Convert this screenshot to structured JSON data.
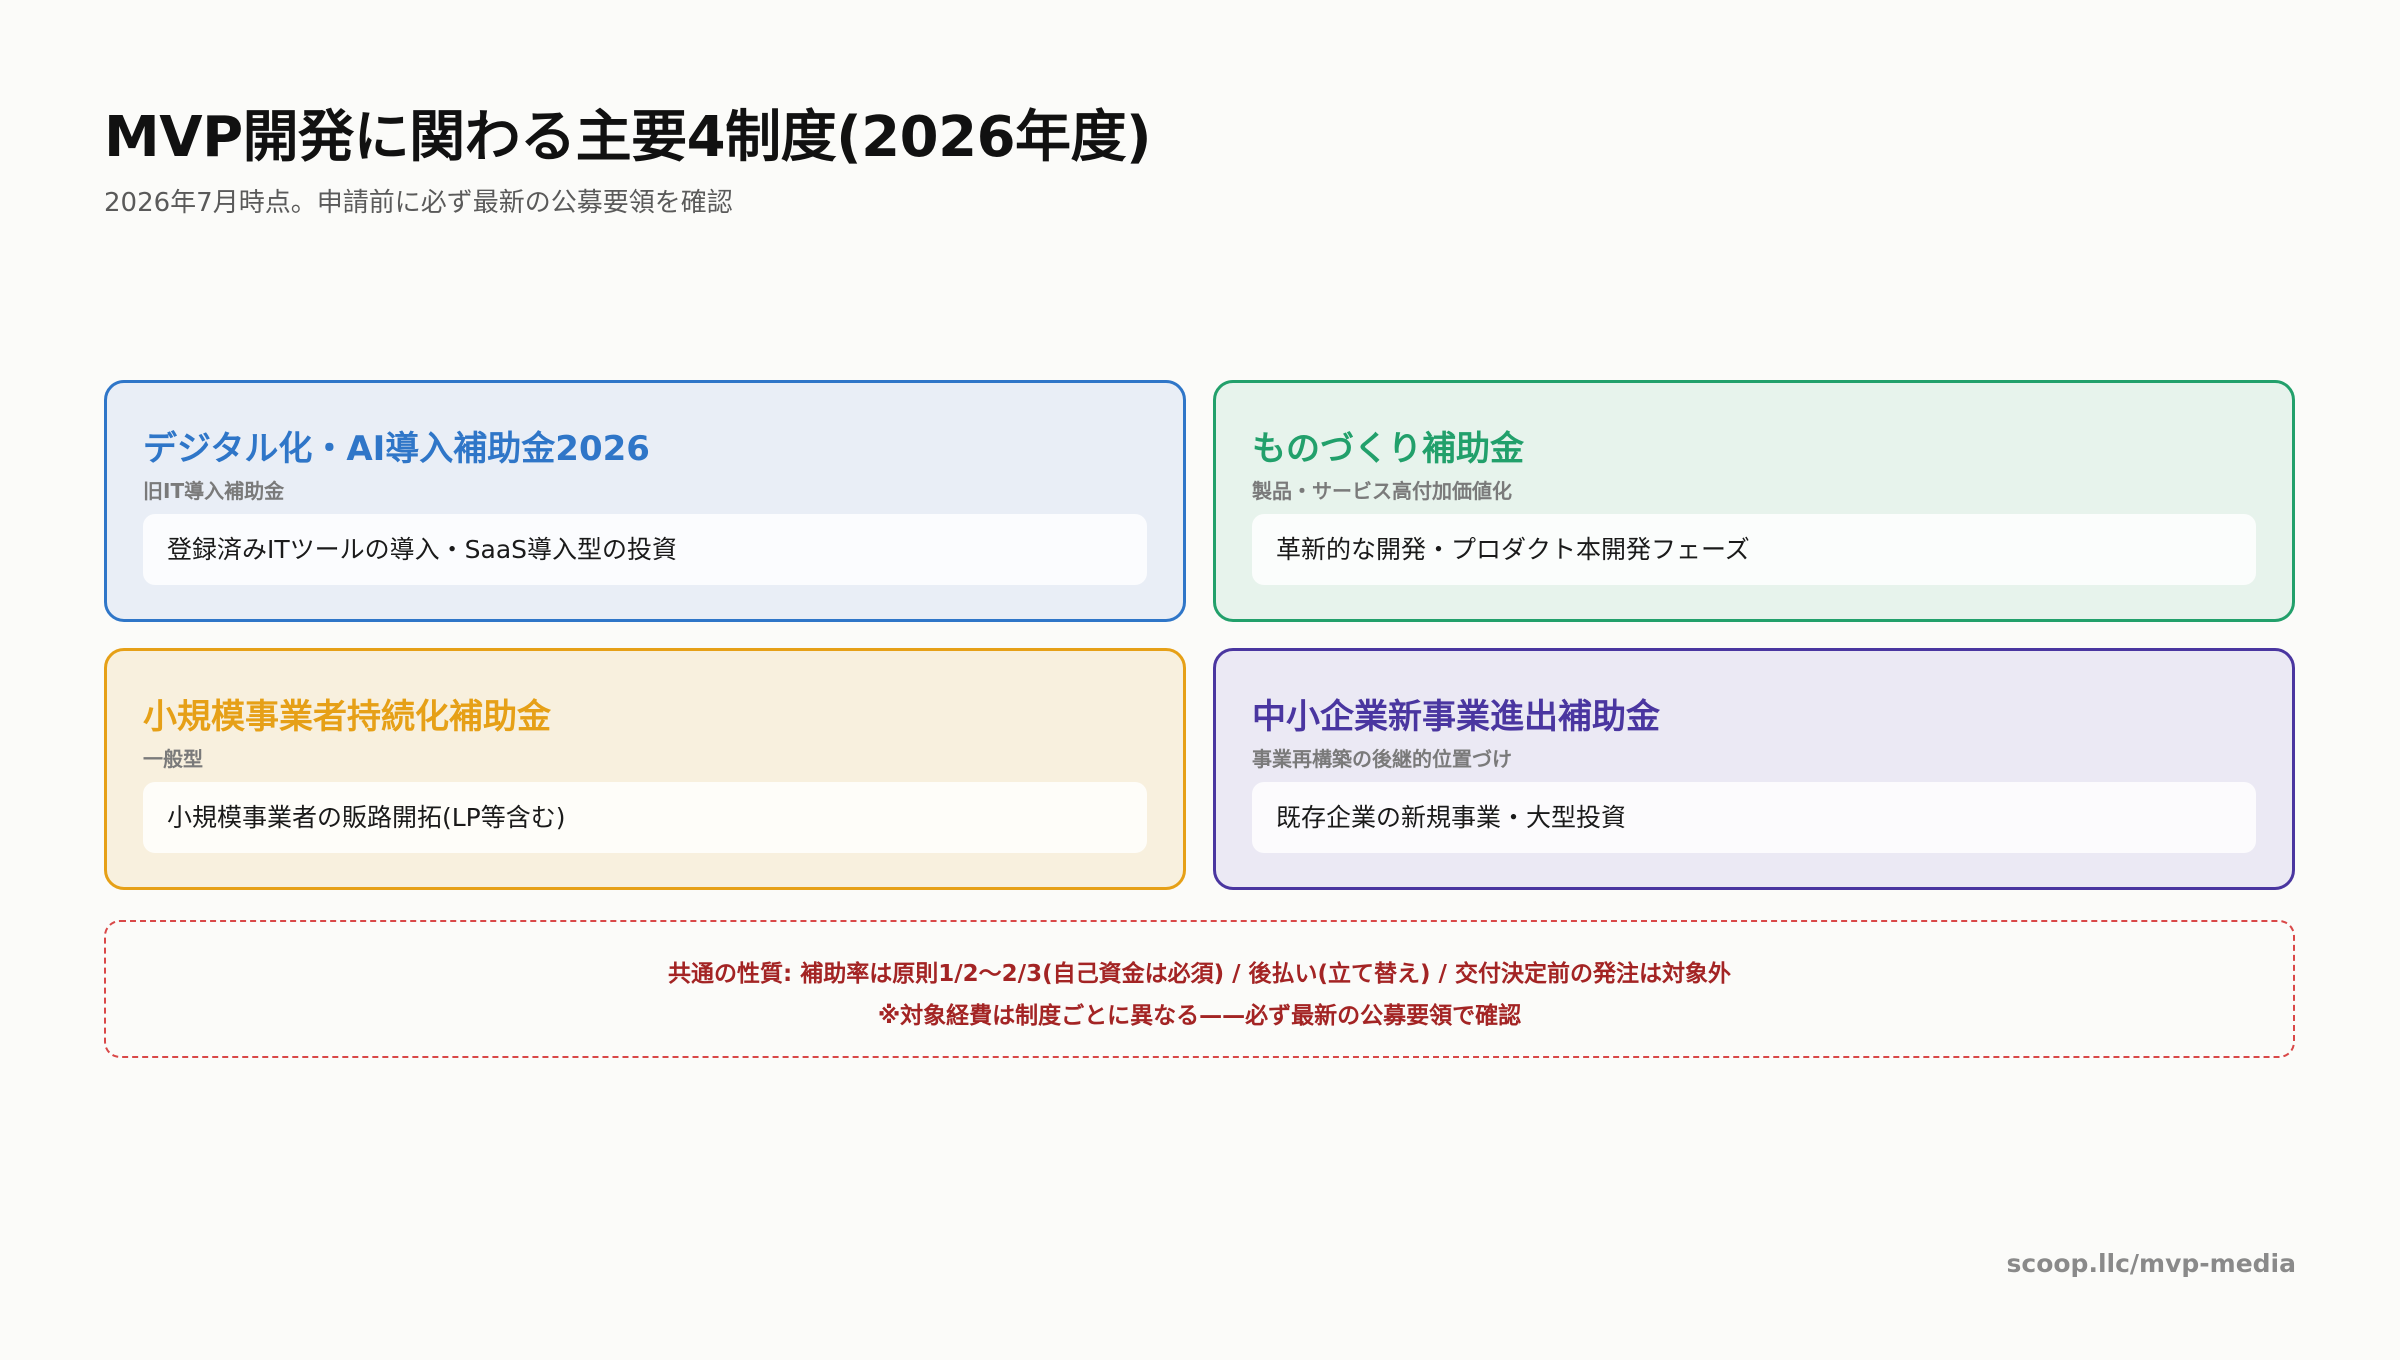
{
  "header": {
    "title": "MVP開発に関わる主要4制度(2026年度)",
    "subtitle": "2026年7月時点。申請前に必ず最新の公募要領を確認"
  },
  "cards": [
    {
      "title": "デジタル化・AI導入補助金2026",
      "subtitle": "旧IT導入補助金",
      "description": "登録済みITツールの導入・SaaS導入型の投資",
      "accent": "#2f76c8"
    },
    {
      "title": "ものづくり補助金",
      "subtitle": "製品・サービス高付加価値化",
      "description": "革新的な開発・プロダクト本開発フェーズ",
      "accent": "#22a06b"
    },
    {
      "title": "小規模事業者持続化補助金",
      "subtitle": "一般型",
      "description": "小規模事業者の販路開拓(LP等含む)",
      "accent": "#e6a017"
    },
    {
      "title": "中小企業新事業進出補助金",
      "subtitle": "事業再構築の後継的位置づけ",
      "description": "既存企業の新規事業・大型投資",
      "accent": "#4a36a0"
    }
  ],
  "note": {
    "line1": "共通の性質: 補助率は原則1/2〜2/3(自己資金は必須) / 後払い(立て替え) / 交付決定前の発注は対象外",
    "line2": "※対象経費は制度ごとに異なる——必ず最新の公募要領で確認",
    "color": "#a32424"
  },
  "footer": {
    "url": "scoop.llc/mvp-media"
  }
}
